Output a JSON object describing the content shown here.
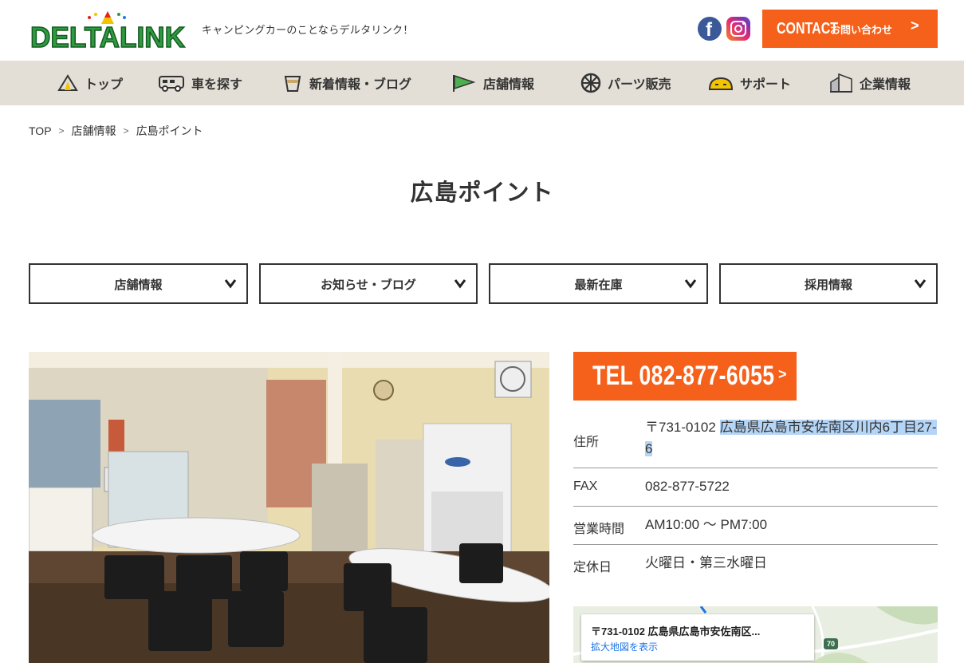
{
  "header": {
    "logo_text": "DELTALINK",
    "tagline": "キャンピングカーのことならデルタリンク！",
    "facebook_glyph": "f",
    "contact": {
      "en": "CONTACT",
      "ja": "お問い合わせ",
      "arrow": ">"
    }
  },
  "nav": {
    "items": [
      {
        "label": "トップ",
        "icon": "tent-icon"
      },
      {
        "label": "車を探す",
        "icon": "camper-icon"
      },
      {
        "label": "新着情報・ブログ",
        "icon": "cup-icon"
      },
      {
        "label": "店舗情報",
        "icon": "flag-icon"
      },
      {
        "label": "パーツ販売",
        "icon": "wheel-icon"
      },
      {
        "label": "サポート",
        "icon": "helmet-icon"
      },
      {
        "label": "企業情報",
        "icon": "building-icon"
      }
    ]
  },
  "breadcrumb": {
    "items": [
      "TOP",
      "店舗情報",
      "広島ポイント"
    ],
    "separator": ">"
  },
  "page_title": "広島ポイント",
  "dropdowns": [
    {
      "label": "店舗情報"
    },
    {
      "label": "お知らせ・ブログ"
    },
    {
      "label": "最新在庫"
    },
    {
      "label": "採用情報"
    }
  ],
  "shop": {
    "tel_button": "TEL 082-877-6055",
    "tel_arrow": ">",
    "address_label": "住所",
    "address_zip": "〒731-0102 ",
    "address_line1": "広島県広島市安佐南区川内6丁目27-",
    "address_line2": "6",
    "fax_label": "FAX",
    "fax": "082-877-5722",
    "hours_label": "営業時間",
    "hours": "AM10:00 〜 PM7:00",
    "closed_label": "定休日",
    "closed": "火曜日・第三水曜日"
  },
  "map": {
    "address": "〒731-0102 広島県広島市安佐南区...",
    "link": "拡大地図を表示",
    "route_number": "70"
  },
  "colors": {
    "accent": "#f5601a",
    "nav_bg": "#e3dfd6",
    "logo_green": "#2e9b3f"
  }
}
